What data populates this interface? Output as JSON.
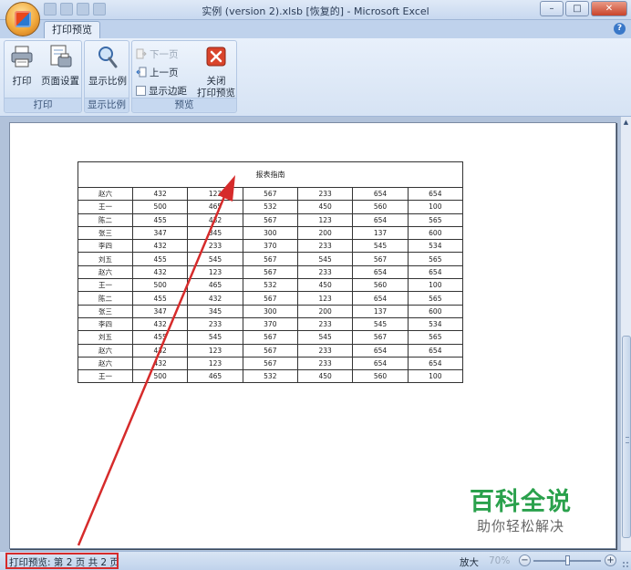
{
  "window": {
    "title": "实例 (version 2).xlsb [恢复的] - Microsoft Excel",
    "min": "–",
    "max": "□",
    "close": "✕"
  },
  "ribbon": {
    "active_tab": "打印预览",
    "groups": {
      "print": {
        "label": "打印",
        "print_button": "打印",
        "page_setup_button": "页面设置"
      },
      "zoom": {
        "label": "显示比例",
        "zoom_button": "显示比例"
      },
      "preview": {
        "label": "预览",
        "next_page": "下一页",
        "prev_page": "上一页",
        "show_margins": "显示边距",
        "close_line1": "关闭",
        "close_line2": "打印预览"
      }
    }
  },
  "sheet": {
    "title": "报表指南",
    "rows": [
      [
        "赵六",
        "432",
        "123",
        "567",
        "233",
        "654",
        "654"
      ],
      [
        "王一",
        "500",
        "465",
        "532",
        "450",
        "560",
        "100"
      ],
      [
        "陈二",
        "455",
        "432",
        "567",
        "123",
        "654",
        "565"
      ],
      [
        "张三",
        "347",
        "345",
        "300",
        "200",
        "137",
        "600"
      ],
      [
        "李四",
        "432",
        "233",
        "370",
        "233",
        "545",
        "534"
      ],
      [
        "刘五",
        "455",
        "545",
        "567",
        "545",
        "567",
        "565"
      ],
      [
        "赵六",
        "432",
        "123",
        "567",
        "233",
        "654",
        "654"
      ],
      [
        "王一",
        "500",
        "465",
        "532",
        "450",
        "560",
        "100"
      ],
      [
        "陈二",
        "455",
        "432",
        "567",
        "123",
        "654",
        "565"
      ],
      [
        "张三",
        "347",
        "345",
        "300",
        "200",
        "137",
        "600"
      ],
      [
        "李四",
        "432",
        "233",
        "370",
        "233",
        "545",
        "534"
      ],
      [
        "刘五",
        "455",
        "545",
        "567",
        "545",
        "567",
        "565"
      ],
      [
        "赵六",
        "432",
        "123",
        "567",
        "233",
        "654",
        "654"
      ],
      [
        "赵六",
        "432",
        "123",
        "567",
        "233",
        "654",
        "654"
      ],
      [
        "王一",
        "500",
        "465",
        "532",
        "450",
        "560",
        "100"
      ]
    ]
  },
  "status": {
    "text": "打印预览: 第 2 页  共 2 页",
    "zoom_in": "放大",
    "zoom_level": "70%",
    "zoom_minus": "−",
    "zoom_plus": "+"
  },
  "watermark": {
    "line1": "百科全说",
    "line2": "助你轻松解决"
  },
  "colors": {
    "annotation": "#d62b2b",
    "watermark_green": "#2aa14c"
  }
}
